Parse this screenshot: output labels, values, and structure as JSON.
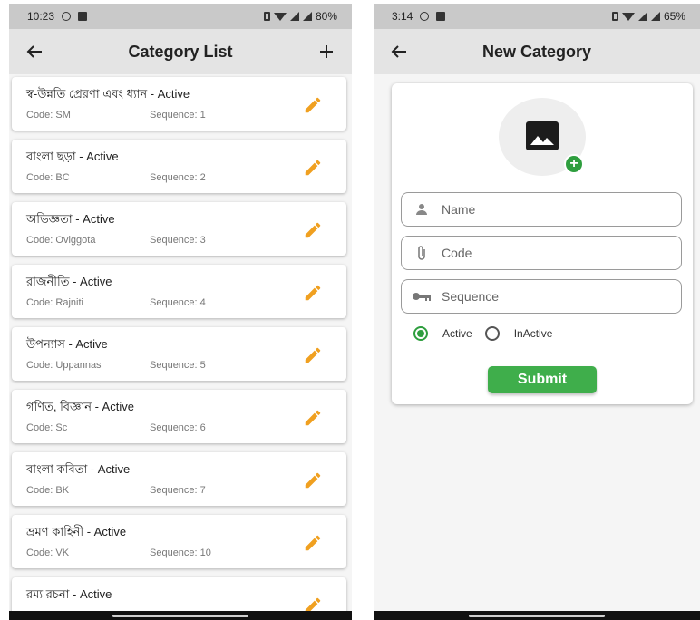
{
  "left": {
    "status": {
      "time": "10:23",
      "battery": "80%"
    },
    "appbar": {
      "title": "Category List"
    },
    "categories": [
      {
        "title": "স্ব-উন্নতি প্রেরণা এবং ধ্যান - Active",
        "code": "Code: SM",
        "sequence": "Sequence: 1"
      },
      {
        "title": "বাংলা ছড়া - Active",
        "code": "Code: BC",
        "sequence": "Sequence: 2"
      },
      {
        "title": "অভিজ্ঞতা - Active",
        "code": "Code: Oviggota",
        "sequence": "Sequence: 3"
      },
      {
        "title": "রাজনীতি - Active",
        "code": "Code: Rajniti",
        "sequence": "Sequence: 4"
      },
      {
        "title": "উপন্যাস - Active",
        "code": "Code: Uppannas",
        "sequence": "Sequence: 5"
      },
      {
        "title": "গণিত, বিজ্ঞান - Active",
        "code": "Code: Sc",
        "sequence": "Sequence: 6"
      },
      {
        "title": "বাংলা কবিতা - Active",
        "code": "Code: BK",
        "sequence": "Sequence: 7"
      },
      {
        "title": "ভ্রমণ কাহিনী - Active",
        "code": "Code: VK",
        "sequence": "Sequence: 10"
      },
      {
        "title": "রম্য রচনা - Active",
        "code": "",
        "sequence": ""
      }
    ]
  },
  "right": {
    "status": {
      "time": "3:14",
      "battery": "65%"
    },
    "appbar": {
      "title": "New Category"
    },
    "form": {
      "name_placeholder": "Name",
      "code_placeholder": "Code",
      "sequence_placeholder": "Sequence",
      "status_options": [
        "Active",
        "InActive"
      ],
      "selected_status": "Active",
      "submit_label": "Submit"
    }
  },
  "colors": {
    "accent_green": "#3fae4b",
    "edit_orange": "#f0a020",
    "appbar_bg": "#e4e4e4"
  },
  "icons": [
    "back-arrow-icon",
    "plus-icon",
    "pencil-icon",
    "image-icon",
    "person-icon",
    "paperclip-icon",
    "key-icon"
  ]
}
